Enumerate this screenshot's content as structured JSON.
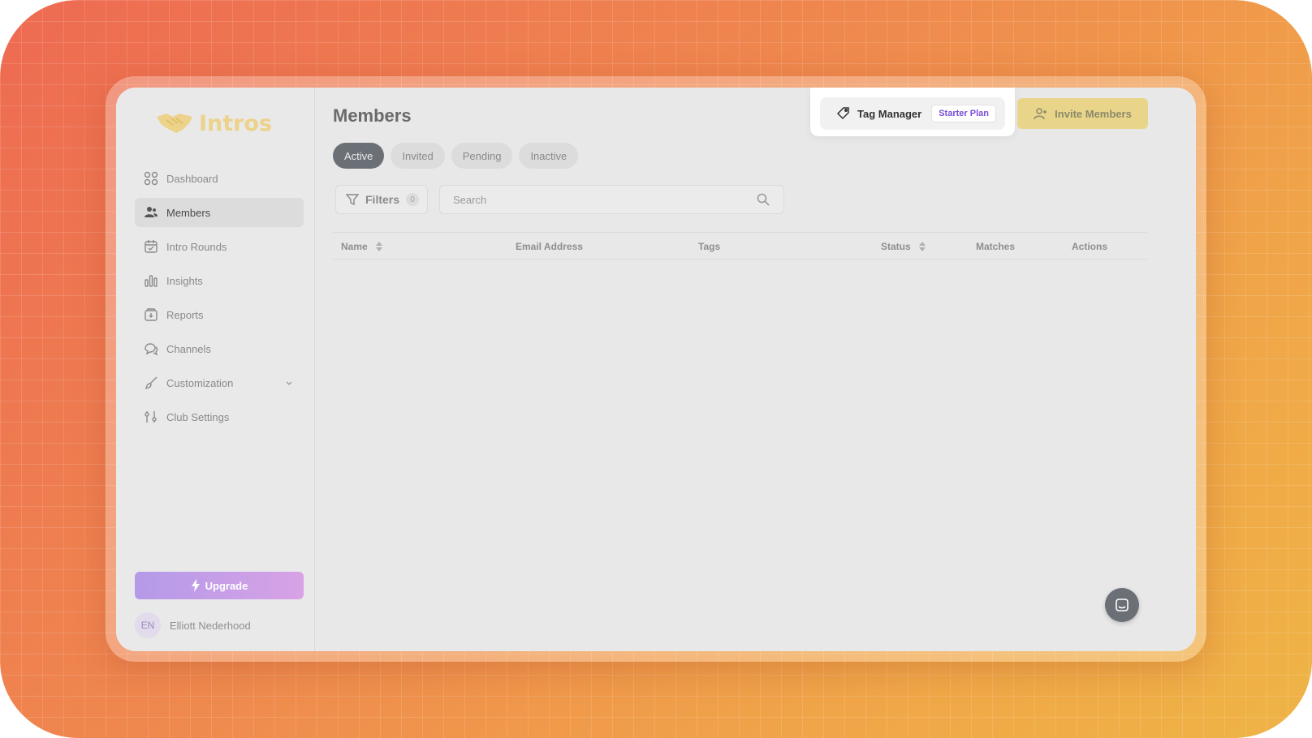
{
  "brand": {
    "name": "Intros"
  },
  "sidebar": {
    "items": [
      {
        "label": "Dashboard",
        "icon": "grid-icon"
      },
      {
        "label": "Members",
        "icon": "users-icon",
        "active": true
      },
      {
        "label": "Intro Rounds",
        "icon": "calendar-icon"
      },
      {
        "label": "Insights",
        "icon": "bar-chart-icon"
      },
      {
        "label": "Reports",
        "icon": "report-icon"
      },
      {
        "label": "Channels",
        "icon": "chat-bubbles-icon"
      },
      {
        "label": "Customization",
        "icon": "brush-icon",
        "expandable": true
      },
      {
        "label": "Club Settings",
        "icon": "sliders-icon"
      }
    ],
    "upgrade_label": "Upgrade",
    "user": {
      "initials": "EN",
      "name": "Elliott Nederhood"
    }
  },
  "header": {
    "title": "Members",
    "tag_manager_label": "Tag Manager",
    "plan_badge": "Starter Plan",
    "invite_label": "Invite Members"
  },
  "tabs": [
    "Active",
    "Invited",
    "Pending",
    "Inactive"
  ],
  "filters": {
    "label": "Filters",
    "count": "0"
  },
  "search": {
    "placeholder": "Search"
  },
  "table": {
    "columns": [
      "Name",
      "Email Address",
      "Tags",
      "Status",
      "Matches",
      "Actions"
    ]
  },
  "colors": {
    "accent_yellow": "#e9d58a",
    "tab_active": "#6b7077",
    "upgrade_gradient_start": "#b49ae8",
    "upgrade_gradient_end": "#d8a2e6",
    "plan_badge_text": "#7a4fd8"
  }
}
